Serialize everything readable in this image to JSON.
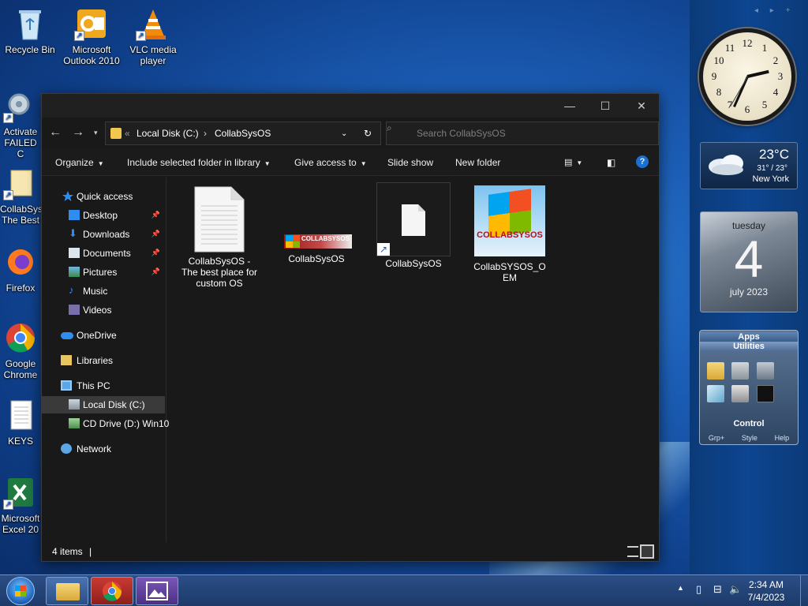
{
  "desktop": {
    "icons": [
      {
        "label": "Recycle Bin"
      },
      {
        "label": "Microsoft Outlook 2010"
      },
      {
        "label": "VLC media player"
      },
      {
        "label": "Activate FAILED C"
      },
      {
        "label": "CollabSys The Best"
      },
      {
        "label": "Firefox"
      },
      {
        "label": "Google Chrome"
      },
      {
        "label": "KEYS"
      },
      {
        "label": "Microsoft Excel 20"
      }
    ]
  },
  "gadgets": {
    "nav_arrows": "◂ ▸ +",
    "weather": {
      "temp": "23°C",
      "range": "31° / 23°",
      "city": "New York"
    },
    "calendar": {
      "day_name": "tuesday",
      "day": "4",
      "month": "july 2023"
    },
    "apps": {
      "title": "Apps",
      "subtitle": "Utilities",
      "control": "Control",
      "footer": [
        "Grp+",
        "Style",
        "Help"
      ]
    }
  },
  "explorer": {
    "address": {
      "root": "Local Disk (C:)",
      "folder": "CollabSysOS"
    },
    "search_placeholder": "Search CollabSysOS",
    "commands": [
      "Organize",
      "Include selected folder in library",
      "Give access to",
      "Slide show",
      "New folder"
    ],
    "nav": {
      "quick_access": "Quick access",
      "desktop": "Desktop",
      "downloads": "Downloads",
      "documents": "Documents",
      "pictures": "Pictures",
      "music": "Music",
      "videos": "Videos",
      "onedrive": "OneDrive",
      "libraries": "Libraries",
      "this_pc": "This PC",
      "local_disk": "Local Disk (C:)",
      "cd_drive": "CD Drive (D:) Win10",
      "network": "Network"
    },
    "files": [
      {
        "label": "CollabSysOS - The best place for custom OS"
      },
      {
        "label": "CollabSysOS",
        "logo_text": "COLLABSYSOS"
      },
      {
        "label": "CollabSysOS"
      },
      {
        "label": "CollabSYSOS_OEM",
        "logo_text": "COLLABSYSOS"
      }
    ],
    "status": "4 items"
  },
  "taskbar": {
    "time": "2:34 AM",
    "date": "7/4/2023"
  },
  "colors": {
    "accent": "#1a6fd1",
    "folder": "#f3c64e"
  }
}
